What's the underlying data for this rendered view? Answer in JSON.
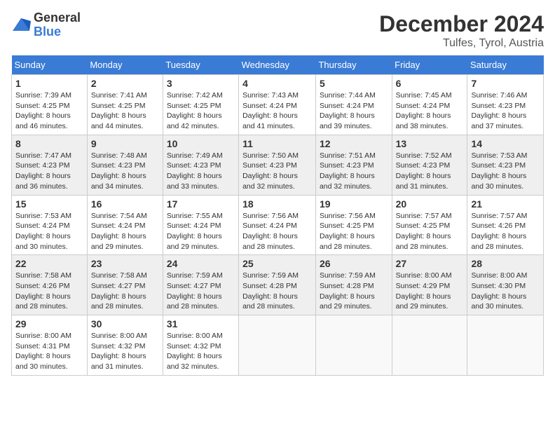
{
  "logo": {
    "general": "General",
    "blue": "Blue"
  },
  "title": "December 2024",
  "location": "Tulfes, Tyrol, Austria",
  "days_of_week": [
    "Sunday",
    "Monday",
    "Tuesday",
    "Wednesday",
    "Thursday",
    "Friday",
    "Saturday"
  ],
  "weeks": [
    [
      {
        "day": "1",
        "sunrise": "7:39 AM",
        "sunset": "4:25 PM",
        "daylight": "8 hours and 46 minutes."
      },
      {
        "day": "2",
        "sunrise": "7:41 AM",
        "sunset": "4:25 PM",
        "daylight": "8 hours and 44 minutes."
      },
      {
        "day": "3",
        "sunrise": "7:42 AM",
        "sunset": "4:25 PM",
        "daylight": "8 hours and 42 minutes."
      },
      {
        "day": "4",
        "sunrise": "7:43 AM",
        "sunset": "4:24 PM",
        "daylight": "8 hours and 41 minutes."
      },
      {
        "day": "5",
        "sunrise": "7:44 AM",
        "sunset": "4:24 PM",
        "daylight": "8 hours and 39 minutes."
      },
      {
        "day": "6",
        "sunrise": "7:45 AM",
        "sunset": "4:24 PM",
        "daylight": "8 hours and 38 minutes."
      },
      {
        "day": "7",
        "sunrise": "7:46 AM",
        "sunset": "4:23 PM",
        "daylight": "8 hours and 37 minutes."
      }
    ],
    [
      {
        "day": "8",
        "sunrise": "7:47 AM",
        "sunset": "4:23 PM",
        "daylight": "8 hours and 36 minutes."
      },
      {
        "day": "9",
        "sunrise": "7:48 AM",
        "sunset": "4:23 PM",
        "daylight": "8 hours and 34 minutes."
      },
      {
        "day": "10",
        "sunrise": "7:49 AM",
        "sunset": "4:23 PM",
        "daylight": "8 hours and 33 minutes."
      },
      {
        "day": "11",
        "sunrise": "7:50 AM",
        "sunset": "4:23 PM",
        "daylight": "8 hours and 32 minutes."
      },
      {
        "day": "12",
        "sunrise": "7:51 AM",
        "sunset": "4:23 PM",
        "daylight": "8 hours and 32 minutes."
      },
      {
        "day": "13",
        "sunrise": "7:52 AM",
        "sunset": "4:23 PM",
        "daylight": "8 hours and 31 minutes."
      },
      {
        "day": "14",
        "sunrise": "7:53 AM",
        "sunset": "4:23 PM",
        "daylight": "8 hours and 30 minutes."
      }
    ],
    [
      {
        "day": "15",
        "sunrise": "7:53 AM",
        "sunset": "4:24 PM",
        "daylight": "8 hours and 30 minutes."
      },
      {
        "day": "16",
        "sunrise": "7:54 AM",
        "sunset": "4:24 PM",
        "daylight": "8 hours and 29 minutes."
      },
      {
        "day": "17",
        "sunrise": "7:55 AM",
        "sunset": "4:24 PM",
        "daylight": "8 hours and 29 minutes."
      },
      {
        "day": "18",
        "sunrise": "7:56 AM",
        "sunset": "4:24 PM",
        "daylight": "8 hours and 28 minutes."
      },
      {
        "day": "19",
        "sunrise": "7:56 AM",
        "sunset": "4:25 PM",
        "daylight": "8 hours and 28 minutes."
      },
      {
        "day": "20",
        "sunrise": "7:57 AM",
        "sunset": "4:25 PM",
        "daylight": "8 hours and 28 minutes."
      },
      {
        "day": "21",
        "sunrise": "7:57 AM",
        "sunset": "4:26 PM",
        "daylight": "8 hours and 28 minutes."
      }
    ],
    [
      {
        "day": "22",
        "sunrise": "7:58 AM",
        "sunset": "4:26 PM",
        "daylight": "8 hours and 28 minutes."
      },
      {
        "day": "23",
        "sunrise": "7:58 AM",
        "sunset": "4:27 PM",
        "daylight": "8 hours and 28 minutes."
      },
      {
        "day": "24",
        "sunrise": "7:59 AM",
        "sunset": "4:27 PM",
        "daylight": "8 hours and 28 minutes."
      },
      {
        "day": "25",
        "sunrise": "7:59 AM",
        "sunset": "4:28 PM",
        "daylight": "8 hours and 28 minutes."
      },
      {
        "day": "26",
        "sunrise": "7:59 AM",
        "sunset": "4:28 PM",
        "daylight": "8 hours and 29 minutes."
      },
      {
        "day": "27",
        "sunrise": "8:00 AM",
        "sunset": "4:29 PM",
        "daylight": "8 hours and 29 minutes."
      },
      {
        "day": "28",
        "sunrise": "8:00 AM",
        "sunset": "4:30 PM",
        "daylight": "8 hours and 30 minutes."
      }
    ],
    [
      {
        "day": "29",
        "sunrise": "8:00 AM",
        "sunset": "4:31 PM",
        "daylight": "8 hours and 30 minutes."
      },
      {
        "day": "30",
        "sunrise": "8:00 AM",
        "sunset": "4:32 PM",
        "daylight": "8 hours and 31 minutes."
      },
      {
        "day": "31",
        "sunrise": "8:00 AM",
        "sunset": "4:32 PM",
        "daylight": "8 hours and 32 minutes."
      },
      null,
      null,
      null,
      null
    ]
  ],
  "labels": {
    "sunrise": "Sunrise:",
    "sunset": "Sunset:",
    "daylight": "Daylight:"
  }
}
